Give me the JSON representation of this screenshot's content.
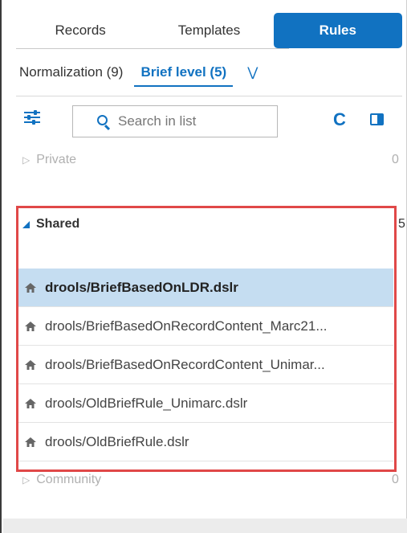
{
  "tabs": [
    {
      "label": "Records",
      "active": false
    },
    {
      "label": "Templates",
      "active": false
    },
    {
      "label": "Rules",
      "active": true
    }
  ],
  "subtabs": [
    {
      "label": "Normalization (9)",
      "active": false
    },
    {
      "label": "Brief level (5)",
      "active": true
    }
  ],
  "more_icon": "»",
  "toolbar": {
    "search_placeholder": "Search in list",
    "filter_icon": "filter-sliders-icon",
    "refresh_icon": "C",
    "panel_icon": "panel-toggle-icon"
  },
  "tree": {
    "private": {
      "label": "Private",
      "count": "0"
    },
    "shared": {
      "label": "Shared",
      "count": "5"
    },
    "community": {
      "label": "Community",
      "count": "0"
    }
  },
  "rules": [
    {
      "label": "drools/BriefBasedOnLDR.dslr",
      "selected": true
    },
    {
      "label": "drools/BriefBasedOnRecordContent_Marc21...",
      "selected": false
    },
    {
      "label": "drools/BriefBasedOnRecordContent_Unimar...",
      "selected": false
    },
    {
      "label": "drools/OldBriefRule_Unimarc.dslr",
      "selected": false
    },
    {
      "label": "drools/OldBriefRule.dslr",
      "selected": false
    }
  ],
  "colors": {
    "accent": "#1172c1",
    "selection": "#c5ddf1",
    "highlight_box": "#e04848"
  }
}
